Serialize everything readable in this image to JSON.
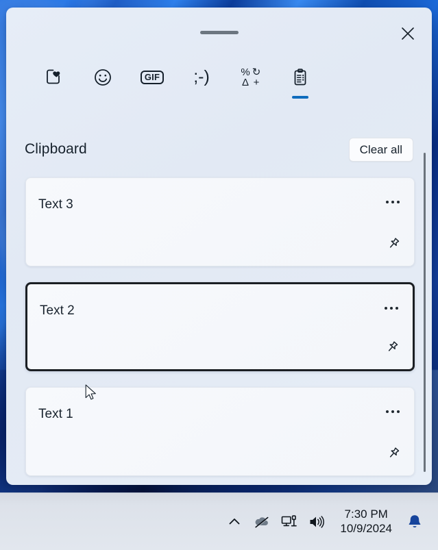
{
  "window": {
    "title": "Emoji and clipboard flyout",
    "drag_handle": "drag-handle",
    "close_label": "Close"
  },
  "tabs": [
    {
      "id": "recent",
      "name": "tab-recently-used",
      "label": "Recently used",
      "icon": "heart-square-icon",
      "active": false
    },
    {
      "id": "emoji",
      "name": "tab-emoji",
      "label": "Emoji",
      "icon": "smiley-face-icon",
      "active": false
    },
    {
      "id": "gif",
      "name": "tab-gif",
      "label": "GIF",
      "icon": "gif-icon",
      "active": false,
      "text": "GIF"
    },
    {
      "id": "kaomoji",
      "name": "tab-kaomoji",
      "label": "Kaomoji",
      "icon": "kaomoji-icon",
      "active": false,
      "text": ";-)"
    },
    {
      "id": "symbols",
      "name": "tab-symbols",
      "label": "Symbols",
      "icon": "symbols-icon",
      "active": false,
      "glyphs": [
        "%",
        "↻",
        "Δ",
        "+"
      ]
    },
    {
      "id": "clipboard",
      "name": "tab-clipboard",
      "label": "Clipboard",
      "icon": "clipboard-icon",
      "active": true
    }
  ],
  "header": {
    "title": "Clipboard",
    "clear_all_label": "Clear all"
  },
  "clipboard_items": [
    {
      "text": "Text 3",
      "selected": false,
      "more_label": "See more",
      "pin_label": "Pin item"
    },
    {
      "text": "Text 2",
      "selected": true,
      "more_label": "See more",
      "pin_label": "Pin item"
    },
    {
      "text": "Text 1",
      "selected": false,
      "more_label": "See more",
      "pin_label": "Pin item"
    }
  ],
  "taskbar": {
    "show_hidden_icons_label": "Show hidden icons",
    "onedrive_label": "OneDrive - not signed in",
    "network_label": "Network - Ethernet",
    "volume_label": "Speakers - volume",
    "time": "7:30 PM",
    "date": "10/9/2024",
    "notifications_label": "Notifications"
  },
  "colors": {
    "accent": "#0f6cbd",
    "panel_bg": "#e3eaf4",
    "card_bg": "#f6f8fc",
    "selected_border": "#1b1f23",
    "text": "#16212c",
    "taskbar_bg": "#dde2ea",
    "bell": "#16449c"
  }
}
